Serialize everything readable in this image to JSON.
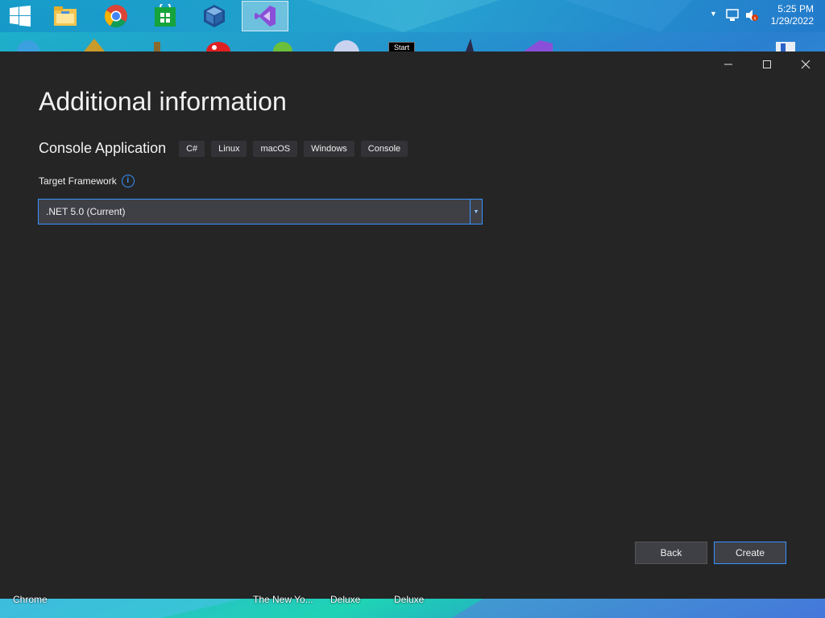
{
  "taskbar": {
    "apps": [
      {
        "name": "windows-start-icon"
      },
      {
        "name": "file-explorer-icon"
      },
      {
        "name": "chrome-icon"
      },
      {
        "name": "store-icon"
      },
      {
        "name": "virtualbox-icon"
      },
      {
        "name": "visual-studio-icon",
        "active": true
      }
    ],
    "clock_time": "5:25 PM",
    "clock_date": "1/29/2022"
  },
  "tooltip": "Start",
  "window": {
    "title": "Additional information",
    "template_name": "Console Application",
    "tags": [
      "C#",
      "Linux",
      "macOS",
      "Windows",
      "Console"
    ],
    "framework_label": "Target Framework",
    "framework_value": ".NET 5.0 (Current)",
    "back_label": "Back",
    "create_label": "Create",
    "info_glyph": "i"
  },
  "desktop_labels": [
    "Chrome",
    "The New Yo...",
    "Deluxe",
    "Deluxe"
  ],
  "colors": {
    "dialog_bg": "#252526",
    "accent": "#3794ff",
    "input_bg": "#3f3f46"
  }
}
